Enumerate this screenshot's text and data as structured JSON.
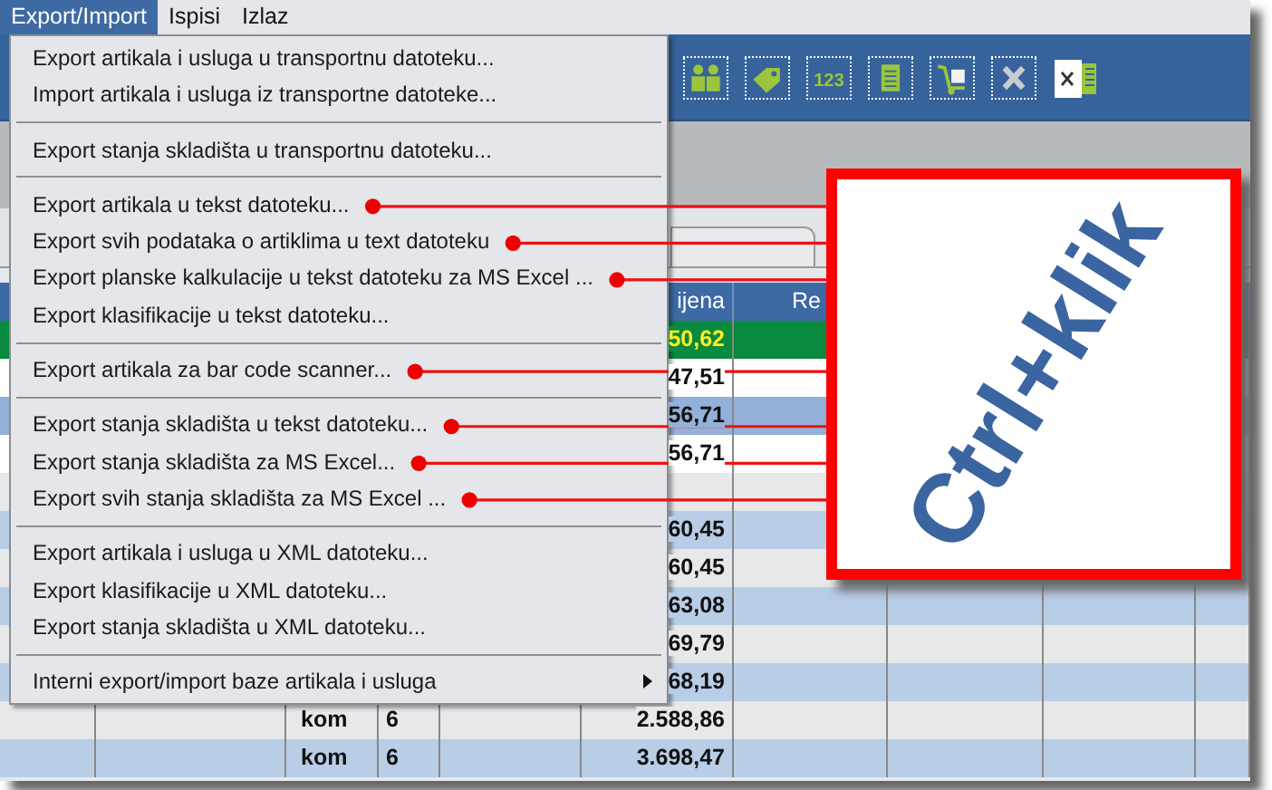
{
  "menubar": [
    {
      "label": "Export/Import",
      "selected": true
    },
    {
      "label": "Ispisi",
      "selected": false
    },
    {
      "label": "Izlaz",
      "selected": false
    }
  ],
  "menu": [
    {
      "kind": "item",
      "label": "Export artikala i usluga u transportnu datoteku...",
      "annotated": false
    },
    {
      "kind": "item",
      "label": "Import artikala i usluga iz transportne datoteke...",
      "annotated": false
    },
    {
      "kind": "separator"
    },
    {
      "kind": "item",
      "label": "Export stanja skladišta u transportnu datoteku...",
      "annotated": false
    },
    {
      "kind": "separator"
    },
    {
      "kind": "item",
      "label": "Export artikala u tekst datoteku...",
      "annotated": true
    },
    {
      "kind": "item",
      "label": "Export svih podataka o artiklima u text datoteku",
      "annotated": true
    },
    {
      "kind": "item",
      "label": "Export planske kalkulacije u tekst datoteku za MS Excel ...",
      "annotated": true
    },
    {
      "kind": "item",
      "label": "Export klasifikacije u tekst datoteku...",
      "annotated": false
    },
    {
      "kind": "separator"
    },
    {
      "kind": "item",
      "label": "Export artikala za bar code scanner...",
      "annotated": true
    },
    {
      "kind": "separator"
    },
    {
      "kind": "item",
      "label": "Export stanja skladišta u tekst datoteku...",
      "annotated": true
    },
    {
      "kind": "item",
      "label": "Export stanja skladišta za MS Excel...",
      "annotated": true
    },
    {
      "kind": "item",
      "label": "Export svih stanja skladišta za MS Excel ...",
      "annotated": true
    },
    {
      "kind": "separator"
    },
    {
      "kind": "item",
      "label": "Export artikala i usluga u XML datoteku...",
      "annotated": false
    },
    {
      "kind": "item",
      "label": "Export klasifikacije u XML datoteku...",
      "annotated": false
    },
    {
      "kind": "item",
      "label": "Export stanja skladišta u XML datoteku...",
      "annotated": false
    },
    {
      "kind": "separator"
    },
    {
      "kind": "submenu",
      "label": "Interni export/import baze artikala i usluga",
      "annotated": false
    }
  ],
  "toolbar": [
    {
      "kind": "people"
    },
    {
      "kind": "tag"
    },
    {
      "kind": "numbers",
      "label": "123"
    },
    {
      "kind": "document"
    },
    {
      "kind": "cart"
    },
    {
      "kind": "delete"
    },
    {
      "kind": "excel"
    }
  ],
  "table": {
    "columns": [
      {
        "label": "ijena"
      },
      {
        "label": "Re"
      }
    ],
    "rows": [
      {
        "kind": "current",
        "price": "50,62"
      },
      {
        "kind": "white",
        "price": "47,51"
      },
      {
        "kind": "marked",
        "price": "56,71"
      },
      {
        "kind": "white",
        "price": "56,71"
      },
      {
        "kind": "normal"
      },
      {
        "kind": "normal",
        "price": "60,45"
      },
      {
        "kind": "normal",
        "price": "60,45"
      },
      {
        "kind": "normal",
        "price": "63,08"
      },
      {
        "kind": "normal",
        "price": "69,79"
      },
      {
        "kind": "normal",
        "price": "68,19"
      },
      {
        "kind": "normal",
        "unit": "kom",
        "quantity": "6",
        "price": "2.588,86"
      },
      {
        "kind": "normal",
        "unit": "kom",
        "quantity": "6",
        "price": "3.698,47"
      }
    ]
  },
  "callout": {
    "text": "Ctrl+klik"
  }
}
